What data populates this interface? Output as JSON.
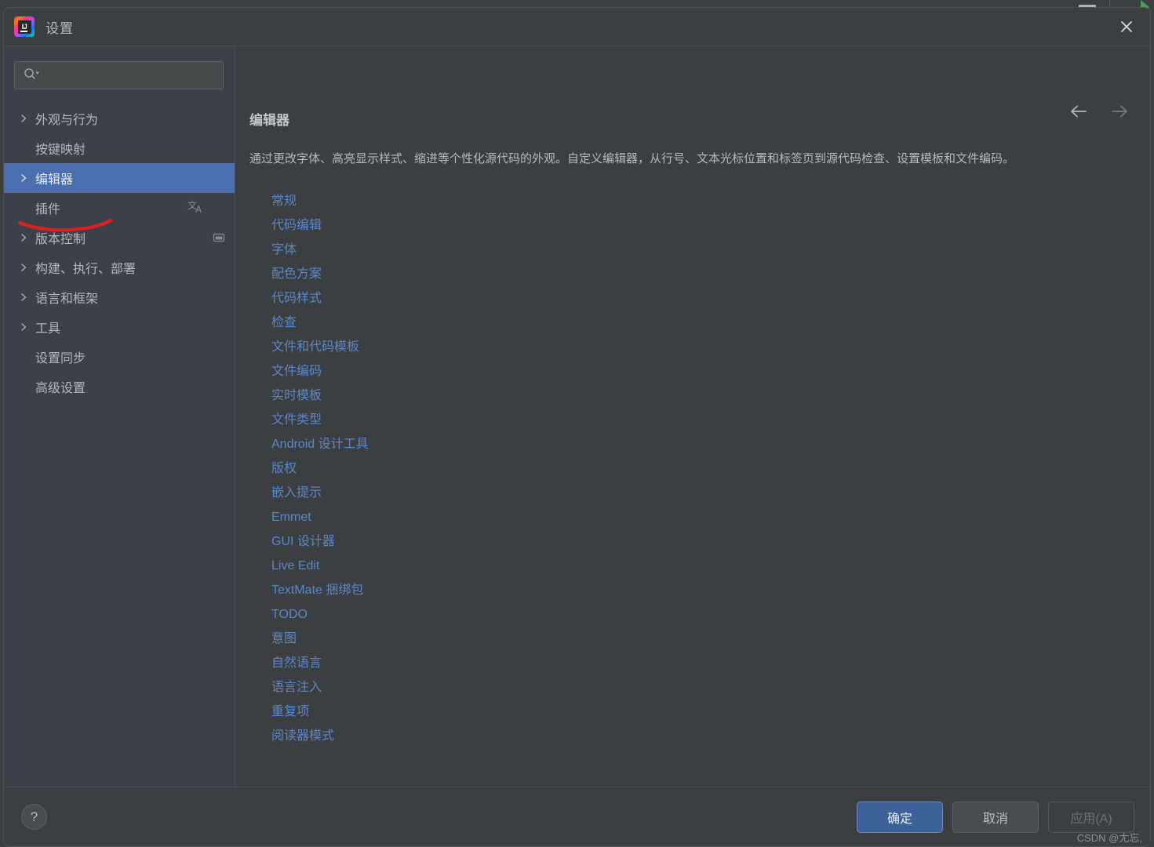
{
  "window": {
    "title": "设置",
    "logo_text": "IJ",
    "close_icon": "close-icon",
    "backdrop": {
      "minimize_icon": "minimize-icon",
      "run_icon": "run-triangle-icon"
    }
  },
  "search": {
    "value": "",
    "placeholder": "",
    "icon": "search-icon"
  },
  "sidebar": {
    "items": [
      {
        "label": "外观与行为",
        "expandable": true,
        "selected": false,
        "trailing_icon": ""
      },
      {
        "label": "按键映射",
        "expandable": false,
        "selected": false,
        "trailing_icon": ""
      },
      {
        "label": "编辑器",
        "expandable": true,
        "selected": true,
        "trailing_icon": ""
      },
      {
        "label": "插件",
        "expandable": false,
        "selected": false,
        "trailing_icon": "translate-icon"
      },
      {
        "label": "版本控制",
        "expandable": true,
        "selected": false,
        "trailing_icon": "window-icon"
      },
      {
        "label": "构建、执行、部署",
        "expandable": true,
        "selected": false,
        "trailing_icon": ""
      },
      {
        "label": "语言和框架",
        "expandable": true,
        "selected": false,
        "trailing_icon": ""
      },
      {
        "label": "工具",
        "expandable": true,
        "selected": false,
        "trailing_icon": ""
      },
      {
        "label": "设置同步",
        "expandable": false,
        "selected": false,
        "trailing_icon": ""
      },
      {
        "label": "高级设置",
        "expandable": false,
        "selected": false,
        "trailing_icon": ""
      }
    ],
    "annotation_color": "#e02020"
  },
  "content": {
    "heading": "编辑器",
    "description": "通过更改字体、高亮显示样式、缩进等个性化源代码的外观。自定义编辑器，从行号、文本光标位置和标签页到源代码检查、设置模板和文件编码。",
    "nav": {
      "back_icon": "arrow-left-icon",
      "forward_icon": "arrow-right-icon",
      "back_enabled": true,
      "forward_enabled": false
    },
    "links": [
      "常规",
      "代码编辑",
      "字体",
      "配色方案",
      "代码样式",
      "检查",
      "文件和代码模板",
      "文件编码",
      "实时模板",
      "文件类型",
      "Android 设计工具",
      "版权",
      "嵌入提示",
      "Emmet",
      "GUI 设计器",
      "Live Edit",
      "TextMate 捆绑包",
      "TODO",
      "意图",
      "自然语言",
      "语言注入",
      "重复项",
      "阅读器模式"
    ]
  },
  "footer": {
    "help_label": "?",
    "ok_label": "确定",
    "cancel_label": "取消",
    "apply_label": "应用(A)",
    "watermark": "CSDN @尢忘,"
  },
  "colors": {
    "selection_blue": "#4b6eaf",
    "link_blue": "#5b87c9",
    "primary_button": "#3c6098",
    "sidebar_bg": "#3c4149",
    "content_bg": "#3c3f41",
    "annotation_red": "#e02020"
  }
}
